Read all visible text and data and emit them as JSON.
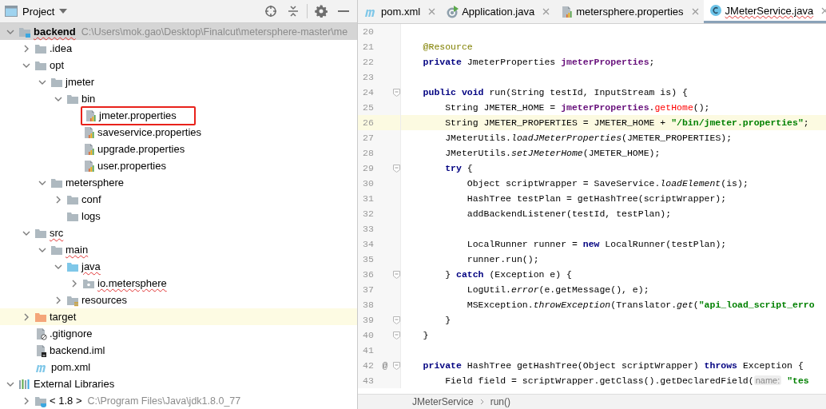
{
  "project_panel": {
    "title": "Project",
    "tree": [
      {
        "label": "backend",
        "kind": "module",
        "path": "C:\\Users\\mok.gao\\Desktop\\Finalcut\\metersphere-master\\me",
        "expanded": true,
        "selected": true,
        "highlighted": false,
        "outlined": false,
        "spell_error": true,
        "children": [
          {
            "label": ".idea",
            "kind": "folder",
            "expanded": false,
            "selected": false,
            "highlighted": false,
            "outlined": false,
            "spell_error": false
          },
          {
            "label": "opt",
            "kind": "folder",
            "expanded": true,
            "selected": false,
            "highlighted": false,
            "outlined": false,
            "spell_error": false,
            "children": [
              {
                "label": "jmeter",
                "kind": "folder",
                "expanded": true,
                "selected": false,
                "highlighted": false,
                "outlined": false,
                "spell_error": false,
                "children": [
                  {
                    "label": "bin",
                    "kind": "folder",
                    "expanded": true,
                    "selected": false,
                    "highlighted": false,
                    "outlined": false,
                    "spell_error": false,
                    "children": [
                      {
                        "label": "jmeter.properties",
                        "kind": "properties",
                        "selected": false,
                        "highlighted": false,
                        "outlined": true,
                        "spell_error": false
                      },
                      {
                        "label": "saveservice.properties",
                        "kind": "properties",
                        "selected": false,
                        "highlighted": false,
                        "outlined": false,
                        "spell_error": false
                      },
                      {
                        "label": "upgrade.properties",
                        "kind": "properties",
                        "selected": false,
                        "highlighted": false,
                        "outlined": false,
                        "spell_error": false
                      },
                      {
                        "label": "user.properties",
                        "kind": "properties",
                        "selected": false,
                        "highlighted": false,
                        "outlined": false,
                        "spell_error": false
                      }
                    ]
                  }
                ]
              },
              {
                "label": "metersphere",
                "kind": "folder",
                "expanded": true,
                "selected": false,
                "highlighted": false,
                "outlined": false,
                "spell_error": false,
                "children": [
                  {
                    "label": "conf",
                    "kind": "folder",
                    "expanded": false,
                    "selected": false,
                    "highlighted": false,
                    "outlined": false,
                    "spell_error": false
                  },
                  {
                    "label": "logs",
                    "kind": "folder",
                    "selected": false,
                    "highlighted": false,
                    "outlined": false,
                    "spell_error": false
                  }
                ]
              }
            ]
          },
          {
            "label": "src",
            "kind": "folder",
            "expanded": true,
            "selected": false,
            "highlighted": false,
            "outlined": false,
            "spell_error": true,
            "children": [
              {
                "label": "main",
                "kind": "folder",
                "expanded": true,
                "selected": false,
                "highlighted": false,
                "outlined": false,
                "spell_error": true,
                "children": [
                  {
                    "label": "java",
                    "kind": "source-folder",
                    "expanded": true,
                    "selected": false,
                    "highlighted": false,
                    "outlined": false,
                    "spell_error": true,
                    "children": [
                      {
                        "label": "io.metersphere",
                        "kind": "package",
                        "expanded": false,
                        "selected": false,
                        "highlighted": false,
                        "outlined": false,
                        "spell_error": true
                      }
                    ]
                  },
                  {
                    "label": "resources",
                    "kind": "resources",
                    "expanded": false,
                    "selected": false,
                    "highlighted": false,
                    "outlined": false,
                    "spell_error": false
                  }
                ]
              }
            ]
          },
          {
            "label": "target",
            "kind": "excluded-folder",
            "expanded": false,
            "selected": false,
            "highlighted": true,
            "outlined": false,
            "spell_error": false
          },
          {
            "label": ".gitignore",
            "kind": "gitignore",
            "selected": false,
            "highlighted": false,
            "outlined": false,
            "spell_error": false
          },
          {
            "label": "backend.iml",
            "kind": "iml",
            "selected": false,
            "highlighted": false,
            "outlined": false,
            "spell_error": false
          },
          {
            "label": "pom.xml",
            "kind": "maven",
            "selected": false,
            "highlighted": false,
            "outlined": false,
            "spell_error": false
          }
        ]
      },
      {
        "label": "External Libraries",
        "kind": "libraries",
        "expanded": true,
        "selected": false,
        "highlighted": false,
        "outlined": false,
        "spell_error": false,
        "children": [
          {
            "label": "< 1.8 >",
            "kind": "jdk",
            "path": "C:\\Program Files\\Java\\jdk1.8.0_77",
            "expanded": false,
            "selected": false,
            "highlighted": false,
            "outlined": false,
            "spell_error": false
          }
        ]
      }
    ]
  },
  "editor": {
    "tabs": [
      {
        "label": "pom.xml",
        "kind": "maven",
        "selected": false,
        "spell_error": false
      },
      {
        "label": "Application.java",
        "kind": "run-class",
        "selected": false,
        "spell_error": false
      },
      {
        "label": "metersphere.properties",
        "kind": "properties",
        "selected": false,
        "spell_error": false
      },
      {
        "label": "JMeterService.java",
        "kind": "class",
        "selected": true,
        "spell_error": true
      }
    ],
    "lines": [
      {
        "number": "20",
        "highlighted": false,
        "fold": false
      },
      {
        "number": "21",
        "highlighted": false,
        "fold": false,
        "tokens": [
          {
            "kind": "ann",
            "text": "    @Resource"
          }
        ]
      },
      {
        "number": "22",
        "highlighted": false,
        "fold": false,
        "tokens": [
          {
            "kind": "kw",
            "text": "    private "
          },
          {
            "kind": "plain",
            "text": "JmeterProperties "
          },
          {
            "kind": "field",
            "text": "jmeterProperties"
          },
          {
            "kind": "plain",
            "text": ";"
          }
        ]
      },
      {
        "number": "23",
        "highlighted": false,
        "fold": false
      },
      {
        "number": "24",
        "highlighted": false,
        "fold": true,
        "tokens": [
          {
            "kind": "kw",
            "text": "    public void "
          },
          {
            "kind": "plain",
            "text": "run(String testId, InputStream is) {"
          }
        ]
      },
      {
        "number": "25",
        "highlighted": false,
        "fold": false,
        "tokens": [
          {
            "kind": "plain",
            "text": "        String JMETER_HOME = "
          },
          {
            "kind": "field",
            "text": "jmeterProperties"
          },
          {
            "kind": "plain",
            "text": "."
          },
          {
            "kind": "error",
            "text": "getHome"
          },
          {
            "kind": "plain",
            "text": "();"
          }
        ]
      },
      {
        "number": "26",
        "highlighted": true,
        "fold": false,
        "tokens": [
          {
            "kind": "plain",
            "text": "        String JMETER_PROPERTIES = JMETER_HOME + "
          },
          {
            "kind": "str",
            "text": "\"/bin/jmeter.properties\""
          },
          {
            "kind": "plain",
            "text": ";"
          }
        ]
      },
      {
        "number": "27",
        "highlighted": false,
        "fold": false,
        "tokens": [
          {
            "kind": "plain",
            "text": "        JMeterUtils."
          },
          {
            "kind": "italic",
            "text": "loadJMeterProperties"
          },
          {
            "kind": "plain",
            "text": "(JMETER_PROPERTIES);"
          }
        ]
      },
      {
        "number": "28",
        "highlighted": false,
        "fold": false,
        "tokens": [
          {
            "kind": "plain",
            "text": "        JMeterUtils."
          },
          {
            "kind": "italic",
            "text": "setJMeterHome"
          },
          {
            "kind": "plain",
            "text": "(JMETER_HOME);"
          }
        ]
      },
      {
        "number": "29",
        "highlighted": false,
        "fold": true,
        "tokens": [
          {
            "kind": "kw",
            "text": "        try "
          },
          {
            "kind": "plain",
            "text": "{"
          }
        ]
      },
      {
        "number": "30",
        "highlighted": false,
        "fold": false,
        "tokens": [
          {
            "kind": "plain",
            "text": "            Object scriptWrapper = SaveService."
          },
          {
            "kind": "italic",
            "text": "loadElement"
          },
          {
            "kind": "plain",
            "text": "(is);"
          }
        ]
      },
      {
        "number": "31",
        "highlighted": false,
        "fold": false,
        "tokens": [
          {
            "kind": "plain",
            "text": "            HashTree testPlan = getHashTree(scriptWrapper);"
          }
        ]
      },
      {
        "number": "32",
        "highlighted": false,
        "fold": false,
        "tokens": [
          {
            "kind": "plain",
            "text": "            addBackendListener(testId, testPlan);"
          }
        ]
      },
      {
        "number": "33",
        "highlighted": false,
        "fold": false
      },
      {
        "number": "34",
        "highlighted": false,
        "fold": false,
        "tokens": [
          {
            "kind": "plain",
            "text": "            LocalRunner runner = "
          },
          {
            "kind": "kw",
            "text": "new "
          },
          {
            "kind": "plain",
            "text": "LocalRunner(testPlan);"
          }
        ]
      },
      {
        "number": "35",
        "highlighted": false,
        "fold": false,
        "tokens": [
          {
            "kind": "plain",
            "text": "            runner.run();"
          }
        ]
      },
      {
        "number": "36",
        "highlighted": false,
        "fold": true,
        "tokens": [
          {
            "kind": "plain",
            "text": "        } "
          },
          {
            "kind": "kw",
            "text": "catch "
          },
          {
            "kind": "plain",
            "text": "(Exception e) {"
          }
        ]
      },
      {
        "number": "37",
        "highlighted": false,
        "fold": false,
        "tokens": [
          {
            "kind": "plain",
            "text": "            LogUtil."
          },
          {
            "kind": "italic",
            "text": "error"
          },
          {
            "kind": "plain",
            "text": "(e.getMessage(), e);"
          }
        ]
      },
      {
        "number": "38",
        "highlighted": false,
        "fold": false,
        "tokens": [
          {
            "kind": "plain",
            "text": "            MSException."
          },
          {
            "kind": "italic",
            "text": "throwException"
          },
          {
            "kind": "plain",
            "text": "(Translator."
          },
          {
            "kind": "italic",
            "text": "get"
          },
          {
            "kind": "plain",
            "text": "("
          },
          {
            "kind": "str",
            "text": "\"api_load_script_erro"
          }
        ]
      },
      {
        "number": "39",
        "highlighted": false,
        "fold": true,
        "tokens": [
          {
            "kind": "plain",
            "text": "        }"
          }
        ]
      },
      {
        "number": "40",
        "highlighted": false,
        "fold": true,
        "tokens": [
          {
            "kind": "plain",
            "text": "    }"
          }
        ]
      },
      {
        "number": "41",
        "highlighted": false,
        "fold": false
      },
      {
        "number": "42",
        "highlighted": false,
        "fold": true,
        "marker": "@",
        "tokens": [
          {
            "kind": "kw",
            "text": "    private "
          },
          {
            "kind": "plain",
            "text": "HashTree getHashTree(Object scriptWrapper) "
          },
          {
            "kind": "kw",
            "text": "throws "
          },
          {
            "kind": "plain",
            "text": "Exception {"
          }
        ]
      },
      {
        "number": "43",
        "highlighted": false,
        "fold": false,
        "tokens": [
          {
            "kind": "plain",
            "text": "        Field field = scriptWrapper.getClass().getDeclaredField("
          },
          {
            "kind": "hint",
            "text": "name:"
          },
          {
            "kind": "str",
            "text": " \"tes"
          }
        ]
      }
    ],
    "breadcrumb": [
      "JMeterService",
      "run()"
    ]
  }
}
